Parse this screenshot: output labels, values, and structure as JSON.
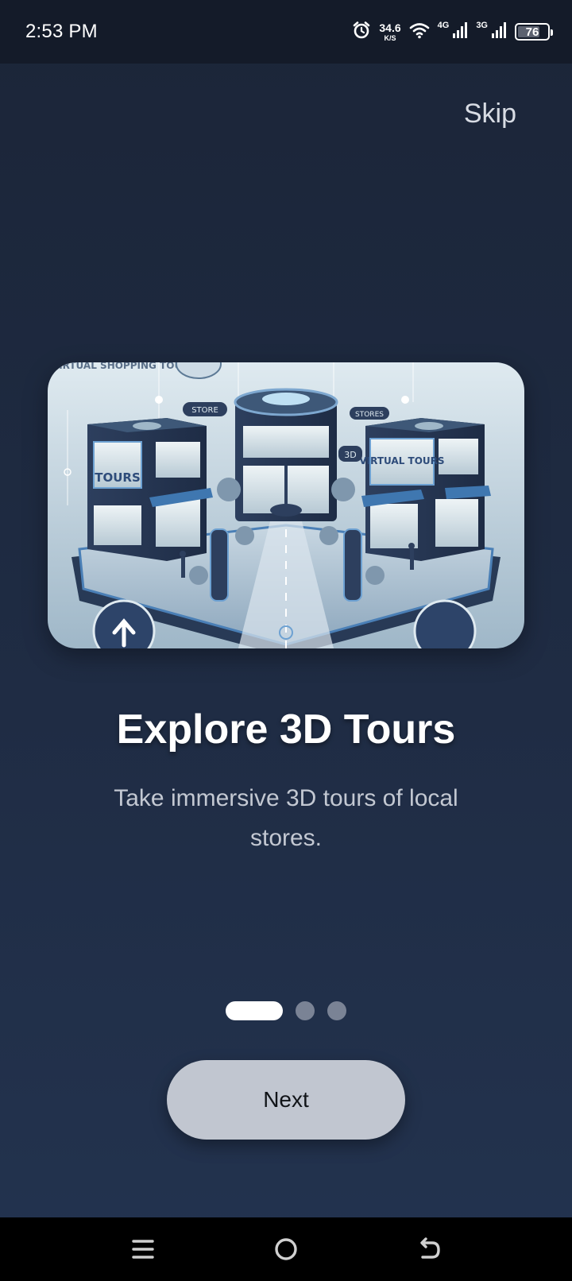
{
  "status_bar": {
    "time": "2:53 PM",
    "net_speed_value": "34.6",
    "net_speed_unit": "K/S",
    "net1": "4G",
    "net2": "3G",
    "battery": "76",
    "battery_level": 0.76,
    "icons": [
      "alarm-icon",
      "wifi-icon",
      "signal-icon",
      "signal-icon",
      "battery-icon"
    ]
  },
  "onboarding": {
    "skip_label": "Skip",
    "title": "Explore 3D Tours",
    "description": "Take immersive 3D tours of local stores.",
    "page_count": 3,
    "current_page": 1,
    "next_label": "Next",
    "illustration": {
      "sign_left_top": "VIRTUAL SHOPPING TOURS",
      "sign_left_store": "TOURS",
      "sign_right_store": "VIRTUAL TOURS",
      "sign_small_1": "STORE",
      "sign_small_2": "STORES",
      "sign_small_3": "3D"
    }
  },
  "nav_bar": {
    "icons": [
      "menu-icon",
      "home-icon",
      "back-icon"
    ]
  },
  "colors": {
    "background_top": "#1b2538",
    "background_bottom": "#23334f",
    "button": "#c1c6d0",
    "dot_active": "#ffffff",
    "dot_inactive": "#7a8395"
  }
}
